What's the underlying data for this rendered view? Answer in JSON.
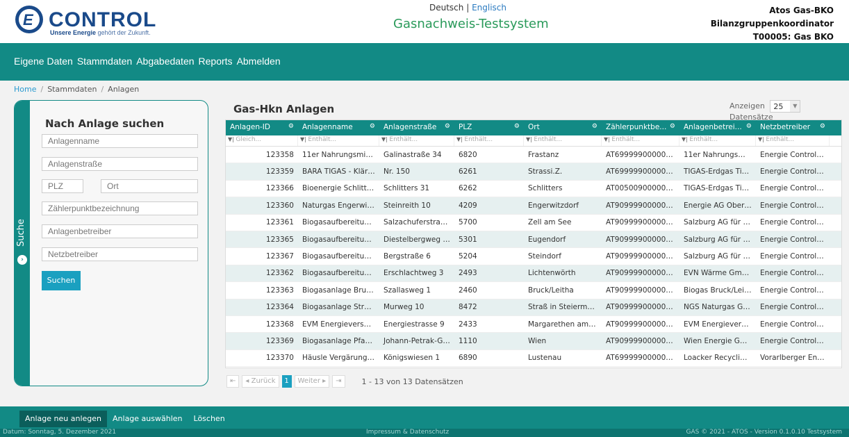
{
  "header": {
    "logo_text": "CONTROL",
    "logo_slogan_bold": "Unsere Energie",
    "logo_slogan_rest": "gehört der Zukunft.",
    "lang_current": "Deutsch",
    "lang_other": "Englisch",
    "app_title": "Gasnachweis-Testsystem",
    "user_line1": "Atos Gas-BKO",
    "user_line2": "Bilanzgruppenkoordinator",
    "user_line3": "T00005: Gas BKO"
  },
  "nav": {
    "items": [
      "Eigene Daten",
      "Stammdaten",
      "Abgabedaten",
      "Reports",
      "Abmelden"
    ]
  },
  "breadcrumb": {
    "home": "Home",
    "level1": "Stammdaten",
    "level2": "Anlagen"
  },
  "search": {
    "tab_label": "Suche",
    "title": "Nach Anlage suchen",
    "anlagenname": "Anlagenname",
    "anlagenstrasse": "Anlagenstraße",
    "plz": "PLZ",
    "ort": "Ort",
    "zaehlerpunkt": "Zählerpunktbezeichnung",
    "anlagenbetreiber": "Anlagenbetreiber",
    "netzbetreiber": "Netzbetreiber",
    "button": "Suchen"
  },
  "grid": {
    "title": "Gas-Hkn Anlagen",
    "show_label": "Anzeigen",
    "page_size": "25",
    "records_label": "Datensätze",
    "columns": [
      "Anlagen-ID",
      "Anlagenname",
      "Anlagenstraße",
      "PLZ",
      "Ort",
      "Zählerpunktbe...",
      "Anlagenbetrei...",
      "Netzbetreiber"
    ],
    "filters": [
      "Gleich...",
      "Enthält...",
      "Enthält...",
      "Enthält...",
      "Enthält...",
      "Enthält...",
      "Enthält...",
      "Enthält..."
    ],
    "rows": [
      [
        "123358",
        "11er Nahrungsmittel...",
        "Galinastraße 34",
        "6820",
        "Frastanz",
        "AT699999000000000...",
        "11er Nahrungsmittel...",
        "Energie Control Gm..."
      ],
      [
        "123359",
        "BARA TIGAS - Kläran...",
        "Nr. 150",
        "6261",
        "Strassi.Z.",
        "AT699999000000000...",
        "TIGAS-Erdgas Tirol G...",
        "Energie Control Gm..."
      ],
      [
        "123366",
        "Bioenergie Schlitters...",
        "Schlitters 31",
        "6262",
        "Schlitters",
        "AT00500900000000S...",
        "TIGAS-Erdgas Tirol G...",
        "Energie Control Gm..."
      ],
      [
        "123360",
        "Naturgas Engerwitzd...",
        "Steinreith 10",
        "4209",
        "Engerwitzdorf",
        "AT909999000000000...",
        "Energie AG Oberöst...",
        "Energie Control Gm..."
      ],
      [
        "123361",
        "Biogasaufbereitungs...",
        "Salzachuferstraße 27...",
        "5700",
        "Zell am See",
        "AT909999000000000...",
        "Salzburg AG für Ener...",
        "Energie Control Gm..."
      ],
      [
        "123365",
        "Biogasaufbereitungs...",
        "Diestelbergweg 21",
        "5301",
        "Eugendorf",
        "AT909999000000000...",
        "Salzburg AG für Ener...",
        "Energie Control Gm..."
      ],
      [
        "123367",
        "Biogasaufbereitungs...",
        "Bergstraße 6",
        "5204",
        "Steindorf",
        "AT909999000000000...",
        "Salzburg AG für Ener...",
        "Energie Control Gm..."
      ],
      [
        "123362",
        "Biogasaufbereitungs...",
        "Erschlachtweg 3",
        "2493",
        "Lichtenwörth",
        "AT909999000000000...",
        "EVN Wärme GmbH",
        "Energie Control Gm..."
      ],
      [
        "123363",
        "Biogasanlage Bruck/...",
        "Szallasweg 1",
        "2460",
        "Bruck/Leitha",
        "AT909999000000000...",
        "Biogas Bruck/Leitha ...",
        "Energie Control Gm..."
      ],
      [
        "123364",
        "Biogasanlage Straß i...",
        "Murweg 10",
        "8472",
        "Straß in Steiermark",
        "AT909999000000000...",
        "NGS Naturgas GmbH",
        "Energie Control Gm..."
      ],
      [
        "123368",
        "EVM Energieversorg...",
        "Energiestrasse 9",
        "2433",
        "Margarethen am Mo...",
        "AT909999000000000...",
        "EVM Energieversorg...",
        "Energie Control Gm..."
      ],
      [
        "123369",
        "Biogasanlage Pfaffe...",
        "Johann-Petrak-Gass...",
        "1110",
        "Wien",
        "AT909999000000000...",
        "Wien Energie GmbH",
        "Energie Control Gm..."
      ],
      [
        "123370",
        "Häusle Vergärungsa...",
        "Königswiesen 1",
        "6890",
        "Lustenau",
        "AT699999000000000...",
        "Loacker Recycling G...",
        "Vorarlberger Energie..."
      ]
    ]
  },
  "pager": {
    "first": "⇤",
    "prev": "◂ Zurück",
    "page": "1",
    "next": "Weiter ▸",
    "last": "⇥",
    "info": "1 - 13 von 13 Datensätzen"
  },
  "footer": {
    "actions": [
      "Anlage neu anlegen",
      "Anlage auswählen",
      "Löschen"
    ],
    "date": "Datum: Sonntag, 5. Dezember 2021",
    "impressum": "Impressum & Datenschutz",
    "version": "GAS © 2021 - ATOS - Version 0.1.0.10 Testsystem"
  }
}
